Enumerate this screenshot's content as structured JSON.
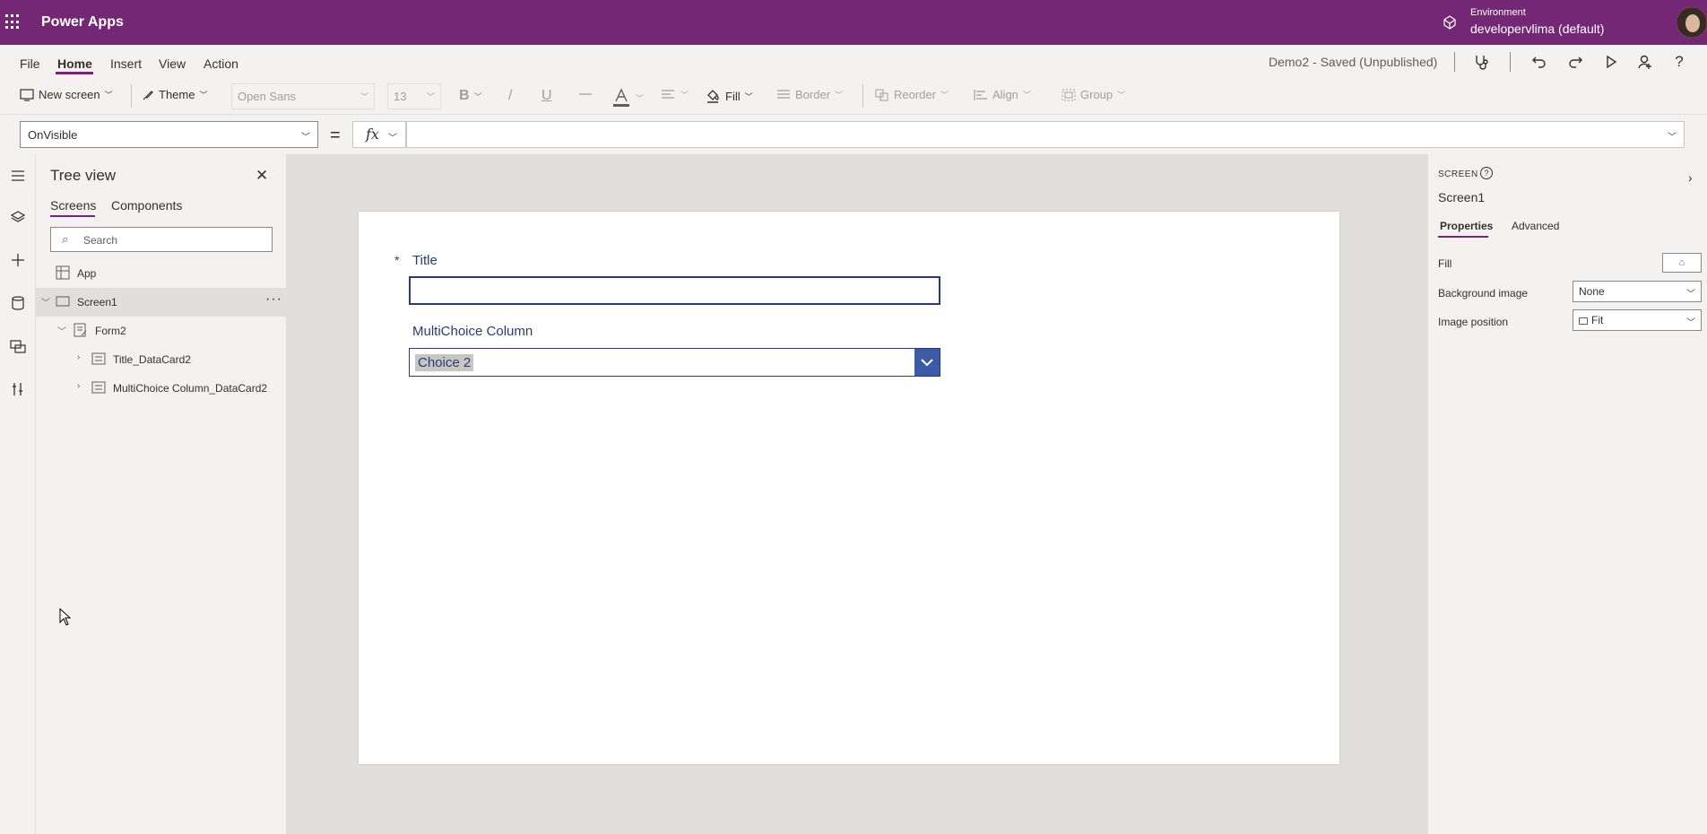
{
  "header": {
    "app_name": "Power Apps",
    "environment_label": "Environment",
    "environment_name": "developervlima (default)"
  },
  "menu": {
    "items": [
      "File",
      "Home",
      "Insert",
      "View",
      "Action"
    ],
    "active": "Home",
    "save_status": "Demo2 - Saved (Unpublished)"
  },
  "ribbon": {
    "new_screen": "New screen",
    "theme": "Theme",
    "font": "Open Sans",
    "font_size": "13",
    "bold": "B",
    "italic": "/",
    "underline": "U",
    "fill": "Fill",
    "border": "Border",
    "reorder": "Reorder",
    "align": "Align",
    "group": "Group"
  },
  "formula_bar": {
    "property": "OnVisible",
    "equals": "=",
    "fx": "fx",
    "formula": ""
  },
  "tree_view": {
    "title": "Tree view",
    "tabs": [
      "Screens",
      "Components"
    ],
    "active_tab": "Screens",
    "search_placeholder": "Search",
    "nodes": {
      "app": "App",
      "screen1": "Screen1",
      "form2": "Form2",
      "title_card": "Title_DataCard2",
      "multichoice_card": "MultiChoice Column_DataCard2"
    },
    "more": "···"
  },
  "canvas": {
    "required_mark": "*",
    "title_label": "Title",
    "title_value": "",
    "multichoice_label": "MultiChoice Column",
    "multichoice_value": "Choice 2"
  },
  "properties": {
    "type": "SCREEN",
    "name": "Screen1",
    "tabs": [
      "Properties",
      "Advanced"
    ],
    "active_tab": "Properties",
    "fill_label": "Fill",
    "background_image_label": "Background image",
    "background_image_value": "None",
    "image_position_label": "Image position",
    "image_position_value": "Fit"
  },
  "colors": {
    "brand": "#742774",
    "form_text": "#2b3b72",
    "dropdown_button": "#3d5aa6"
  }
}
